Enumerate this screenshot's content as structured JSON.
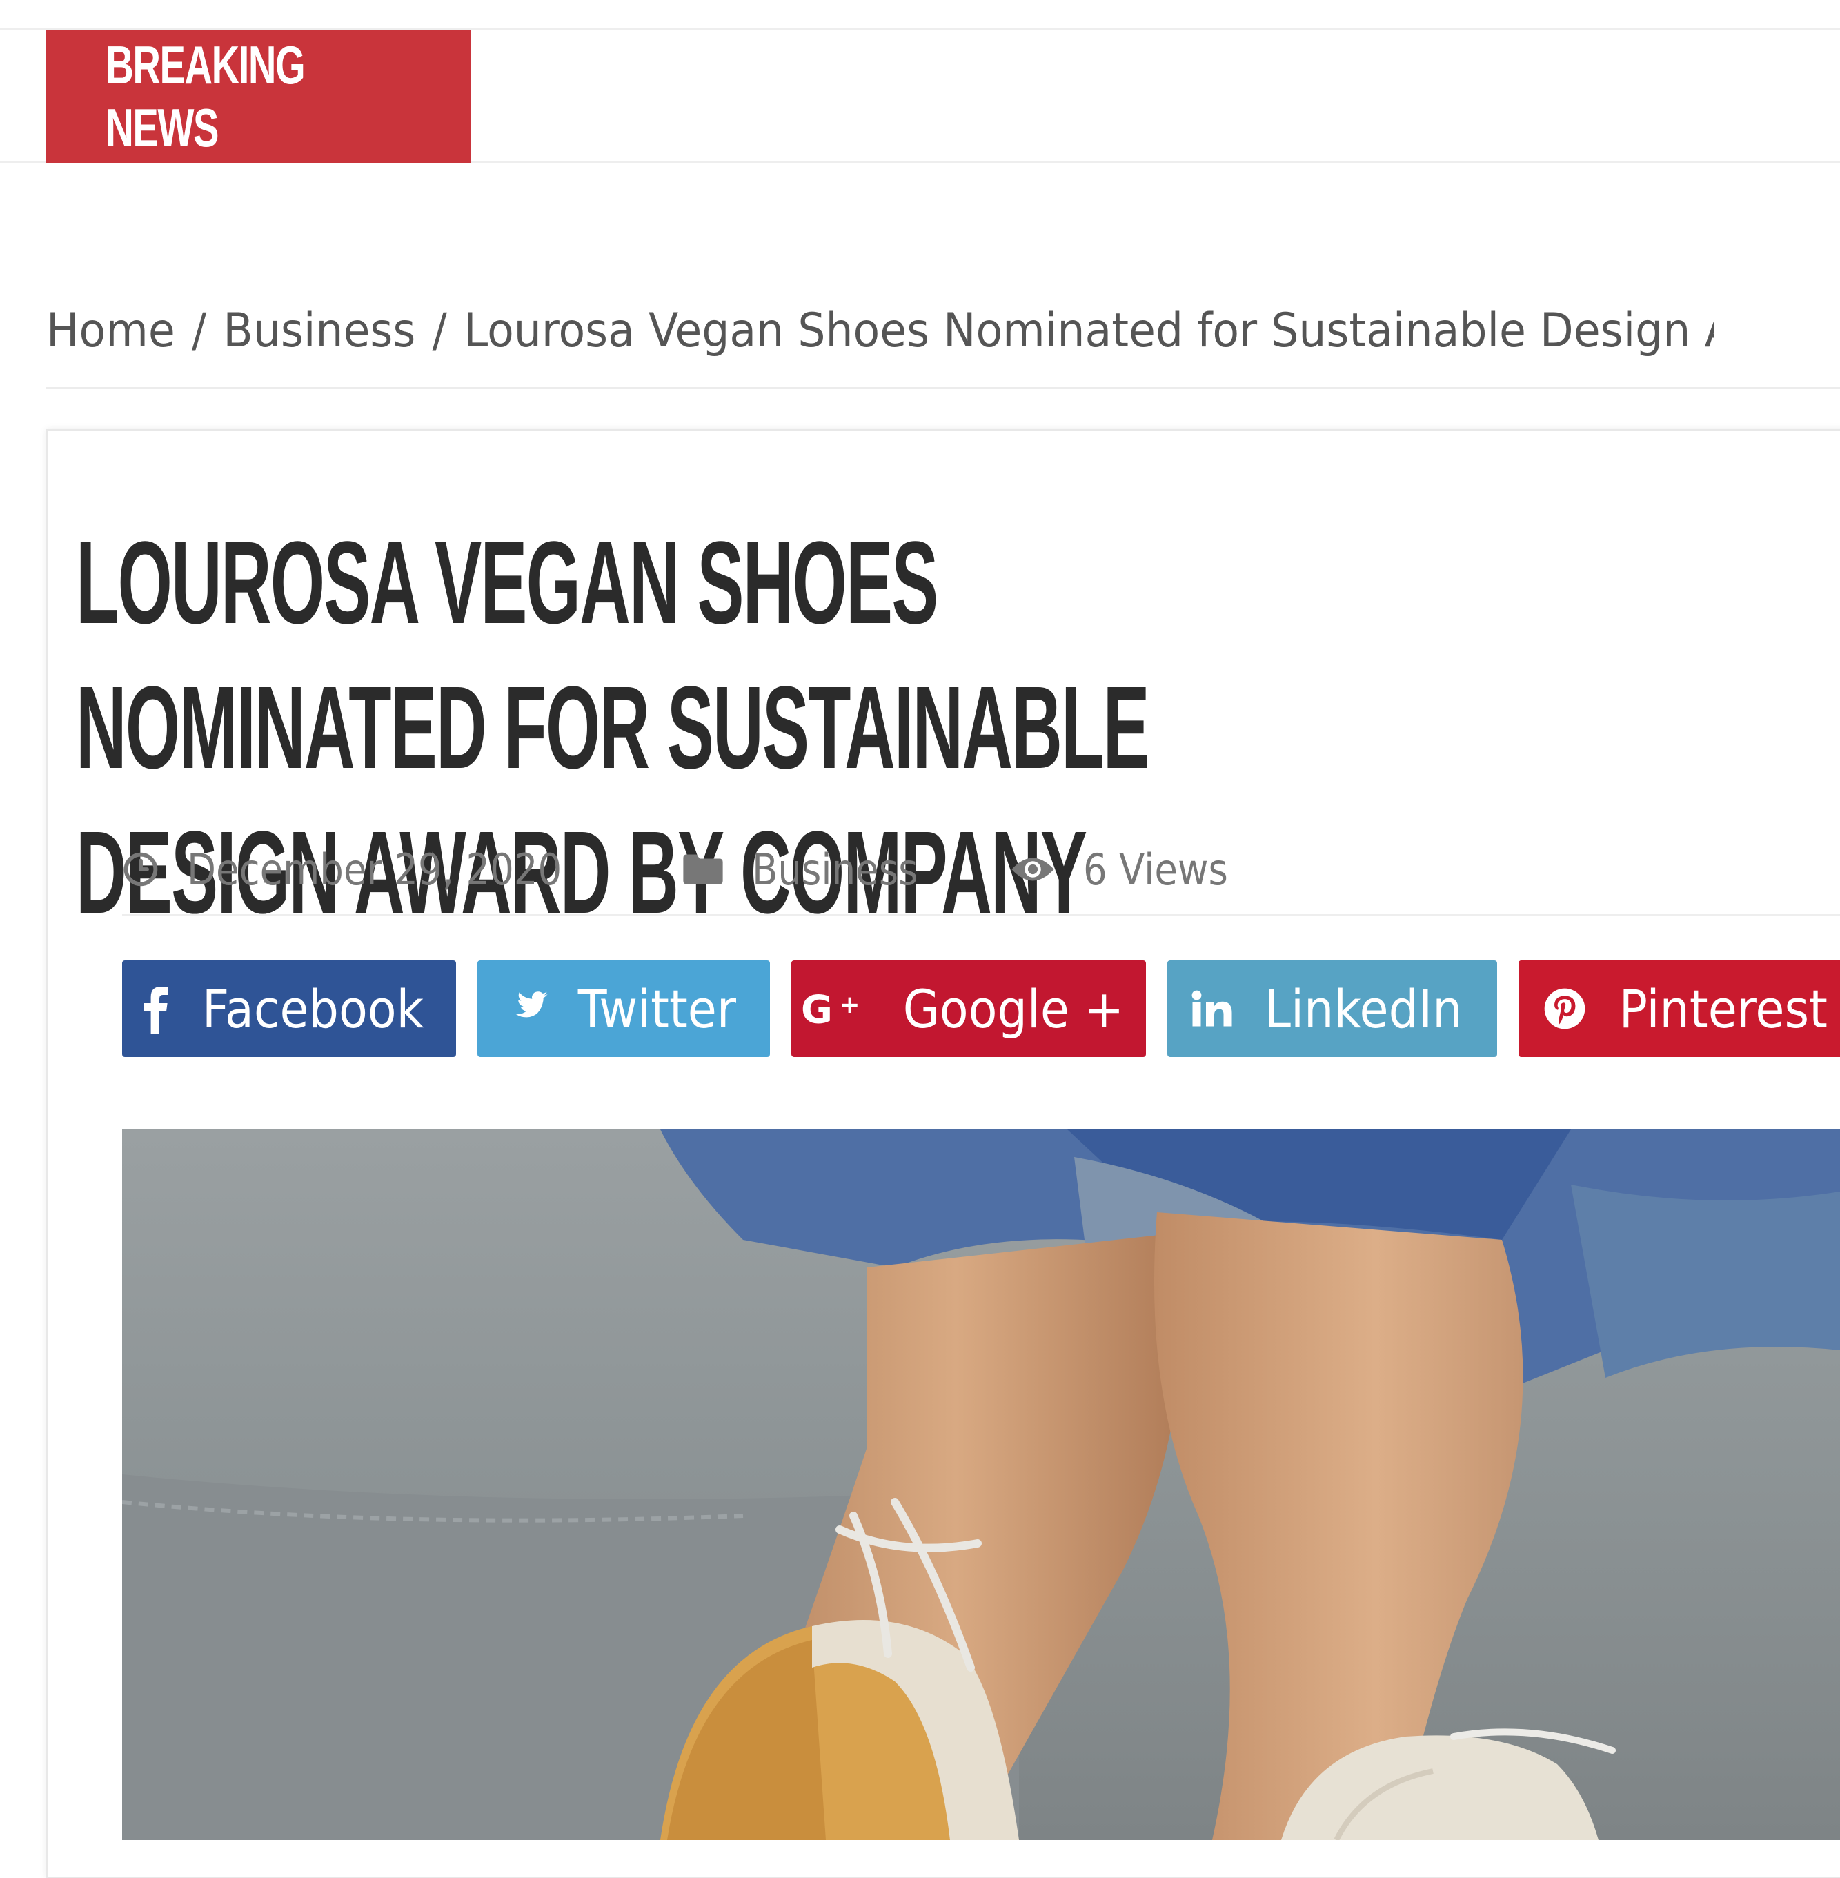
{
  "ticker": {
    "label": "BREAKING NEWS"
  },
  "breadcrumb": {
    "items": [
      "Home",
      "Business",
      "Lourosa Vegan Shoes Nominated for Sustainable Design Award"
    ],
    "separator": "/"
  },
  "article": {
    "title": "Lourosa Vegan Shoes Nominated for Sustainable Design Award by Company",
    "meta": {
      "date": "December 29, 2020",
      "category": "Business",
      "views": "6 Views"
    },
    "share": [
      {
        "label": "Facebook",
        "icon": "facebook-icon",
        "color": "#2f5496"
      },
      {
        "label": "Twitter",
        "icon": "twitter-icon",
        "color": "#4ba5d6"
      },
      {
        "label": "Google +",
        "icon": "google-plus-icon",
        "color": "#c21730"
      },
      {
        "label": "LinkedIn",
        "icon": "linkedin-icon",
        "color": "#57a3c4"
      },
      {
        "label": "Pinterest",
        "icon": "pinterest-icon",
        "color": "#c91a2e"
      }
    ]
  },
  "colors": {
    "accent": "#c9343b",
    "title": "#2b2b2b",
    "meta": "#777777"
  }
}
